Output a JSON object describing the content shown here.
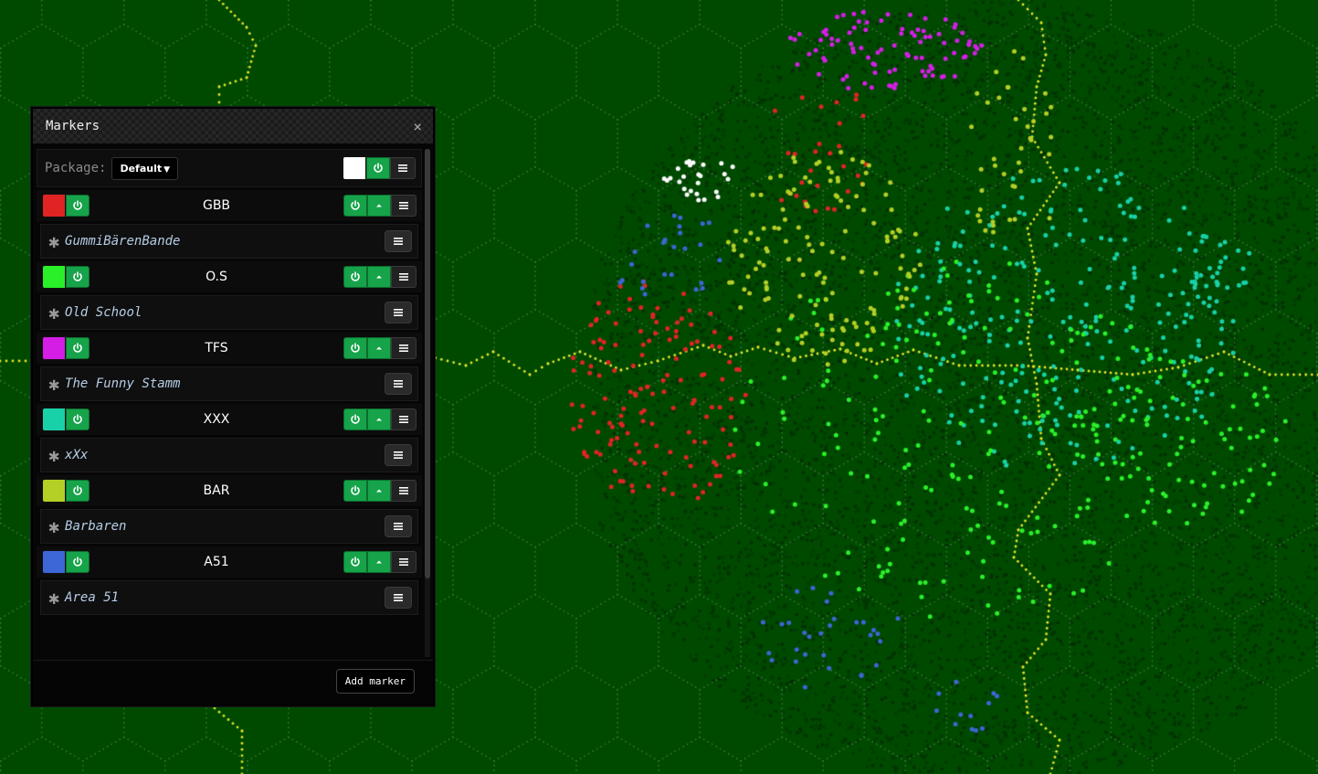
{
  "panel": {
    "title": "Markers",
    "close_icon": "×",
    "package_label": "Package:",
    "package_value": "Default",
    "add_marker_label": "Add marker"
  },
  "markers": [
    {
      "tag": "GBB",
      "name": "GummiBärenBande",
      "color": "#e02424"
    },
    {
      "tag": "O.S",
      "name": "Old School",
      "color": "#2af02a"
    },
    {
      "tag": "TFS",
      "name": "The Funny Stamm",
      "color": "#d41ee6"
    },
    {
      "tag": "XXX",
      "name": "xXx",
      "color": "#19d1a8"
    },
    {
      "tag": "BAR",
      "name": "Barbaren",
      "color": "#b4cf26"
    },
    {
      "tag": "A51",
      "name": "Area 51",
      "color": "#3d66d6"
    }
  ],
  "icons": {
    "power": "power-icon",
    "up": "caret-up-icon",
    "menu": "hamburger-icon",
    "asterisk": "asterisk-icon"
  },
  "map_colors": {
    "background": "#004a00",
    "hex_grid": "#3f7a3f",
    "border": "#e6e62a",
    "own_marker": "#ffffff"
  }
}
